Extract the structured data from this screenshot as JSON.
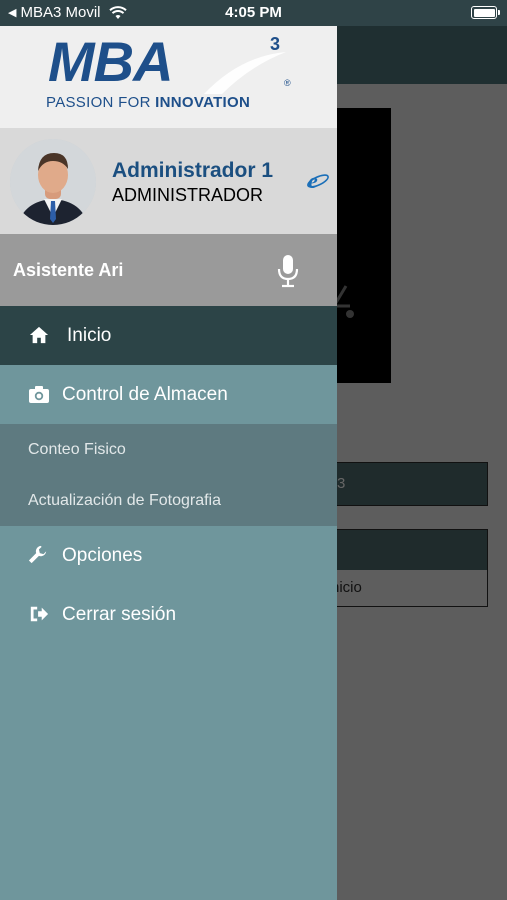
{
  "status_bar": {
    "back_app": "MBA3 Movil",
    "time": "4:05 PM"
  },
  "background": {
    "field_text": "3",
    "card_text": "nicio"
  },
  "logo": {
    "word": "MBA",
    "superscript": "3",
    "tagline_regular": "PASSION FOR ",
    "tagline_bold": "INNOVATION",
    "trademark": "®"
  },
  "profile": {
    "name": "Administrador 1",
    "role": "ADMINISTRADOR",
    "icons": {
      "browser": "internet-explorer-icon"
    }
  },
  "assistant": {
    "label": "Asistente Ari",
    "icon": "microphone-icon"
  },
  "menu": {
    "home": {
      "label": "Inicio",
      "icon": "home-icon"
    },
    "warehouse": {
      "label": "Control de Almacen",
      "icon": "camera-icon",
      "subitems": [
        "Conteo Fisico",
        "Actualización de Fotografia"
      ]
    },
    "options": {
      "label": "Opciones",
      "icon": "wrench-icon"
    },
    "logout": {
      "label": "Cerrar sesión",
      "icon": "sign-out-icon"
    }
  },
  "colors": {
    "drawer": "#6f969c",
    "home_active": "#2c4447",
    "subnav": "#5e7a80",
    "brand": "#1e4f8a"
  }
}
